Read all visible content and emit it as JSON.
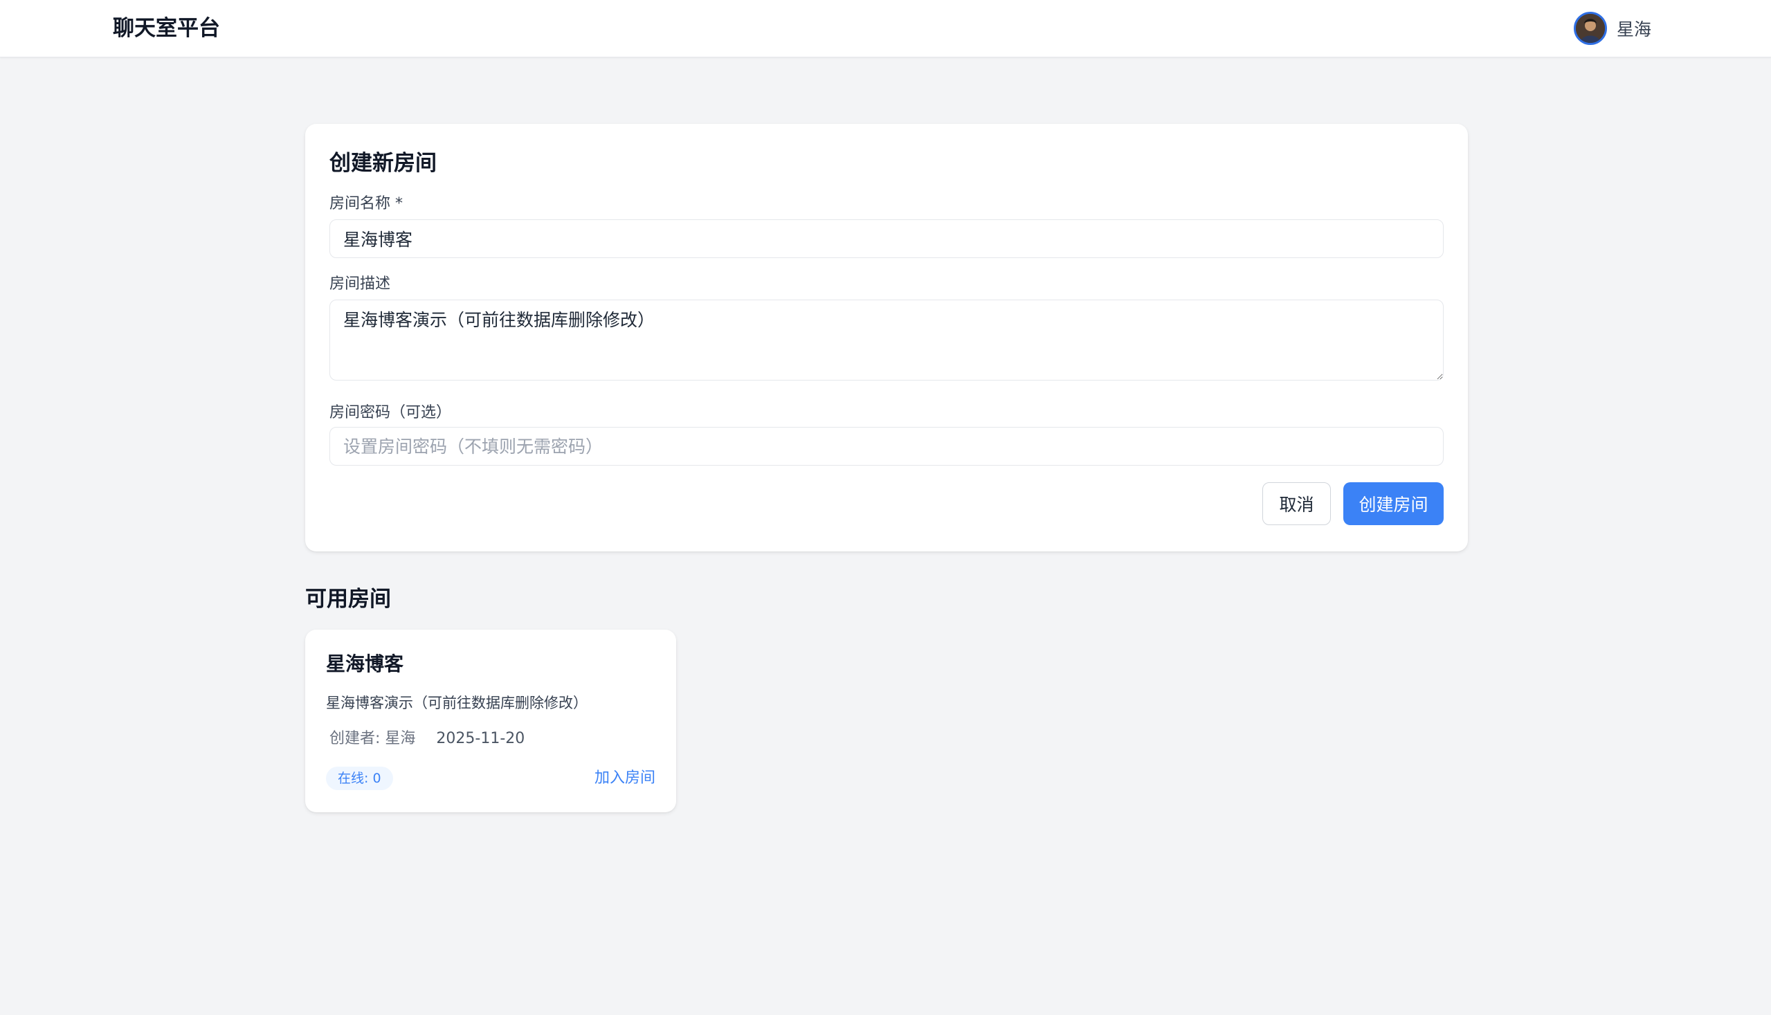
{
  "header": {
    "brand": "聊天室平台",
    "user_name": "星海",
    "avatar_icon": "user-avatar"
  },
  "create_form": {
    "title": "创建新房间",
    "name_label": "房间名称 *",
    "name_value": "星海博客",
    "desc_label": "房间描述",
    "desc_value": "星海博客演示（可前往数据库删除修改）",
    "password_label": "房间密码（可选）",
    "password_placeholder": "设置房间密码（不填则无需密码）",
    "cancel_label": "取消",
    "submit_label": "创建房间"
  },
  "rooms_section": {
    "title": "可用房间",
    "rooms": [
      {
        "name": "星海博客",
        "description": "星海博客演示（可前往数据库删除修改）",
        "creator": "创建者: 星海",
        "date": "2025-11-20",
        "online": "在线: 0",
        "join_label": "加入房间"
      }
    ]
  },
  "colors": {
    "accent": "#3b82f6",
    "page_bg": "#f3f4f6",
    "card_bg": "#ffffff"
  }
}
